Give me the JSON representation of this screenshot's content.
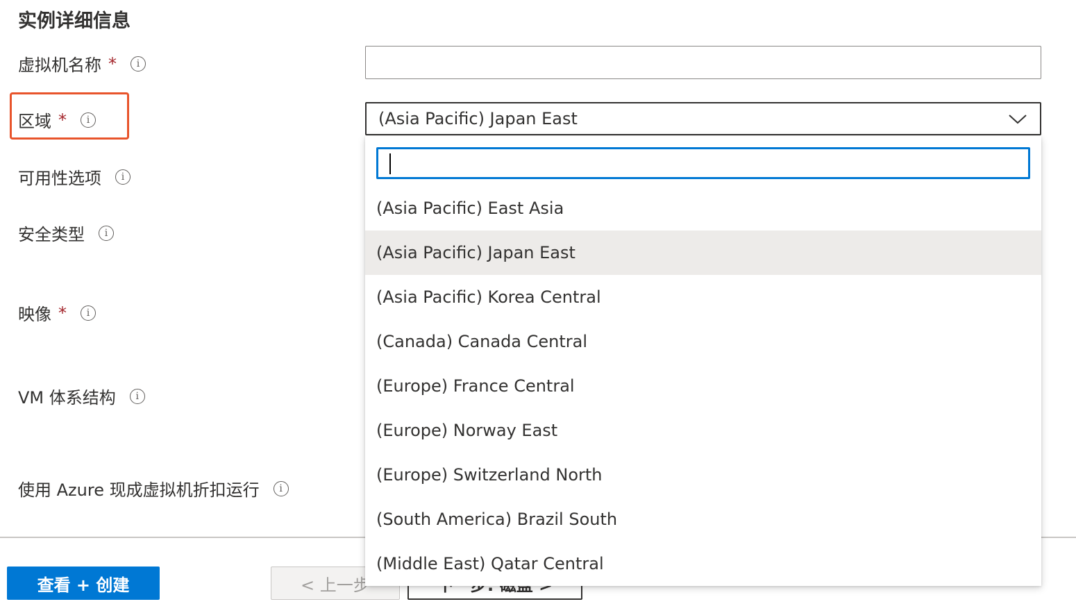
{
  "section": {
    "title": "实例详细信息"
  },
  "fields": {
    "vm_name": {
      "label": "虚拟机名称",
      "required_mark": "*",
      "value": ""
    },
    "region": {
      "label": "区域",
      "required_mark": "*",
      "value": "(Asia Pacific) Japan East"
    },
    "availability": {
      "label": "可用性选项"
    },
    "security_type": {
      "label": "安全类型"
    },
    "image": {
      "label": "映像",
      "required_mark": "*"
    },
    "vm_architecture": {
      "label": "VM 体系结构"
    },
    "azure_spot": {
      "label": "使用 Azure 现成虚拟机折扣运行"
    }
  },
  "info_icon_glyph": "i",
  "region_dropdown": {
    "search_value": "",
    "options": [
      "(Asia Pacific) East Asia",
      "(Asia Pacific) Japan East",
      "(Asia Pacific) Korea Central",
      "(Canada) Canada Central",
      "(Europe) France Central",
      "(Europe) Norway East",
      "(Europe) Switzerland North",
      "(South America) Brazil South",
      "(Middle East) Qatar Central"
    ],
    "selected": "(Asia Pacific) Japan East"
  },
  "footer": {
    "review_create_label": "查看 + 创建",
    "previous_label": "< 上一步",
    "next_label": "下一步: 磁盘 >"
  },
  "colors": {
    "primary": "#0078d4",
    "required": "#a4262c",
    "highlight": "#e8542b",
    "selected_option_bg": "#edebe9"
  }
}
